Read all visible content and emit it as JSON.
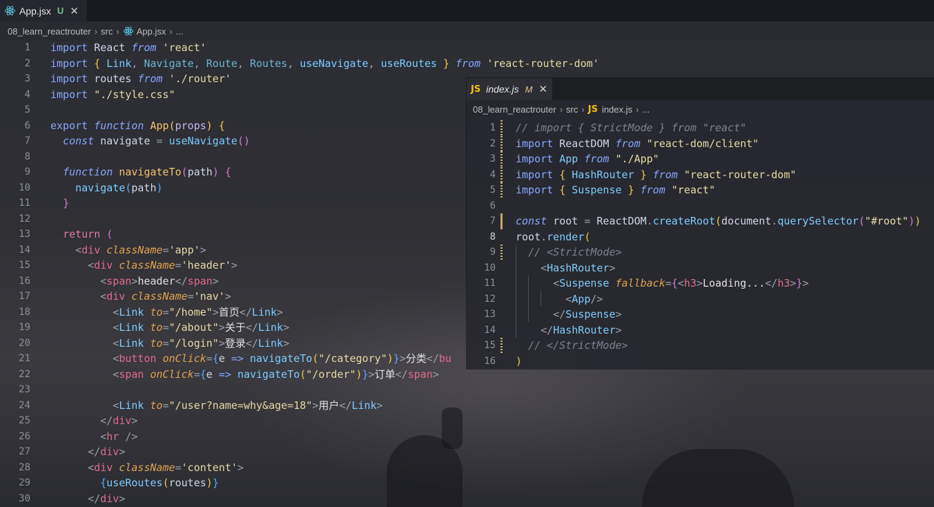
{
  "main": {
    "tab": {
      "filename": "App.jsx",
      "status": "U",
      "close": "✕"
    },
    "breadcrumb": {
      "folder": "08_learn_reactrouter",
      "src": "src",
      "file": "App.jsx",
      "more": "...",
      "sep": "›"
    },
    "lines": [
      "1",
      "2",
      "3",
      "4",
      "5",
      "6",
      "7",
      "8",
      "9",
      "10",
      "11",
      "12",
      "13",
      "14",
      "15",
      "16",
      "17",
      "18",
      "19",
      "20",
      "21",
      "22",
      "23",
      "24",
      "25",
      "26",
      "27",
      "28",
      "29",
      "30"
    ],
    "code": {
      "l1": [
        "import",
        "React",
        "from",
        "'react'"
      ],
      "l2": [
        "import",
        "{",
        "Link",
        "Navigate",
        "Route",
        "Routes",
        "useNavigate",
        "useRoutes",
        "}",
        "from",
        "'react-router-dom'"
      ],
      "l3": [
        "import",
        "routes",
        "from",
        "'./router'"
      ],
      "l4": [
        "import",
        "\"./style.css\""
      ],
      "l6": [
        "export",
        "function",
        "App",
        "(",
        "props",
        ")",
        "{"
      ],
      "l7": [
        "const",
        "navigate",
        "=",
        "useNavigate",
        "()"
      ],
      "l9": [
        "function",
        "navigateTo",
        "(",
        "path",
        ")",
        "{"
      ],
      "l10": [
        "navigate",
        "(",
        "path",
        ")"
      ],
      "l11": [
        "}"
      ],
      "l13": [
        "return",
        "("
      ],
      "l14": [
        "<",
        "div",
        "className",
        "=",
        "'app'",
        ">"
      ],
      "l15": [
        "<",
        "div",
        "className",
        "=",
        "'header'",
        ">"
      ],
      "l16": [
        "<",
        "span",
        ">",
        "header",
        "</",
        "span",
        ">"
      ],
      "l17": [
        "<",
        "div",
        "className",
        "=",
        "'nav'",
        ">"
      ],
      "l18": [
        "<",
        "Link",
        "to",
        "=",
        "\"/home\"",
        ">",
        "首页",
        "</",
        "Link",
        ">"
      ],
      "l19": [
        "<",
        "Link",
        "to",
        "=",
        "\"/about\"",
        ">",
        "关于",
        "</",
        "Link",
        ">"
      ],
      "l20": [
        "<",
        "Link",
        "to",
        "=",
        "\"/login\"",
        ">",
        "登录",
        "</",
        "Link",
        ">"
      ],
      "l21": [
        "<",
        "button",
        "onClick",
        "=",
        "{",
        "e",
        "=>",
        "navigateTo",
        "(",
        "\"/category\"",
        ")",
        "}",
        ">",
        "分类",
        "</",
        "bu"
      ],
      "l22": [
        "<",
        "span",
        "onClick",
        "=",
        "{",
        "e",
        "=>",
        "navigateTo",
        "(",
        "\"/order\"",
        ")",
        "}",
        ">",
        "订单",
        "</",
        "span",
        ">"
      ],
      "l24": [
        "<",
        "Link",
        "to",
        "=",
        "\"/user?name=why&age=18\"",
        ">",
        "用户",
        "</",
        "Link",
        ">"
      ],
      "l25": [
        "</",
        "div",
        ">"
      ],
      "l26": [
        "<",
        "hr",
        "/>"
      ],
      "l27": [
        "</",
        "div",
        ">"
      ],
      "l28": [
        "<",
        "div",
        "className",
        "=",
        "'content'",
        ">"
      ],
      "l29": [
        "{",
        "useRoutes",
        "(",
        "routes",
        ")",
        "}"
      ],
      "l30": [
        "</",
        "div",
        ">"
      ]
    }
  },
  "float": {
    "tab": {
      "filename": "index.js",
      "status": "M",
      "close": "✕",
      "icon": "JS"
    },
    "breadcrumb": {
      "folder": "08_learn_reactrouter",
      "src": "src",
      "icon": "JS",
      "file": "index.js",
      "more": "...",
      "sep": "›"
    },
    "lines": [
      "1",
      "2",
      "3",
      "4",
      "5",
      "6",
      "7",
      "8",
      "9",
      "10",
      "11",
      "12",
      "13",
      "14",
      "15",
      "16"
    ],
    "code": {
      "l1": "// import { StrictMode } from \"react\"",
      "l2": [
        "import",
        "ReactDOM",
        "from",
        "\"react-dom/client\""
      ],
      "l3": [
        "import",
        "App",
        "from",
        "\"./App\""
      ],
      "l4": [
        "import",
        "{",
        "HashRouter",
        "}",
        "from",
        "\"react-router-dom\""
      ],
      "l5": [
        "import",
        "{",
        "Suspense",
        "}",
        "from",
        "\"react\""
      ],
      "l7": [
        "const",
        "root",
        "=",
        "ReactDOM",
        ".",
        "createRoot",
        "(",
        "document",
        ".",
        "querySelector",
        "(",
        "\"#root\"",
        ")",
        ")"
      ],
      "l8": [
        "root",
        ".",
        "render",
        "("
      ],
      "l9": "// <StrictMode>",
      "l10": [
        "<",
        "HashRouter",
        ">"
      ],
      "l11": [
        "<",
        "Suspense",
        "fallback",
        "=",
        "{",
        "<",
        "h3",
        ">",
        "Loading...",
        "</",
        "h3",
        ">",
        "}",
        ">"
      ],
      "l12": [
        "<",
        "App",
        "/>"
      ],
      "l13": [
        "</",
        "Suspense",
        ">"
      ],
      "l14": [
        "</",
        "HashRouter",
        ">"
      ],
      "l15": "// </StrictMode>",
      "l16": [
        ")"
      ]
    }
  },
  "colors": {
    "keyword": "#89a6ff",
    "string": "#e7d9a6",
    "tag": "#e06c8b",
    "attr": "#e0a24f",
    "function": "#7ecbff",
    "bracket": "#f2c94c",
    "git_untracked": "#73c991",
    "git_modified": "#e2c08d",
    "js_icon": "#f1c40f"
  },
  "icons": {
    "react": "react-icon",
    "js": "js-file-icon",
    "close": "close-icon",
    "chevron": "chevron-right-icon"
  }
}
